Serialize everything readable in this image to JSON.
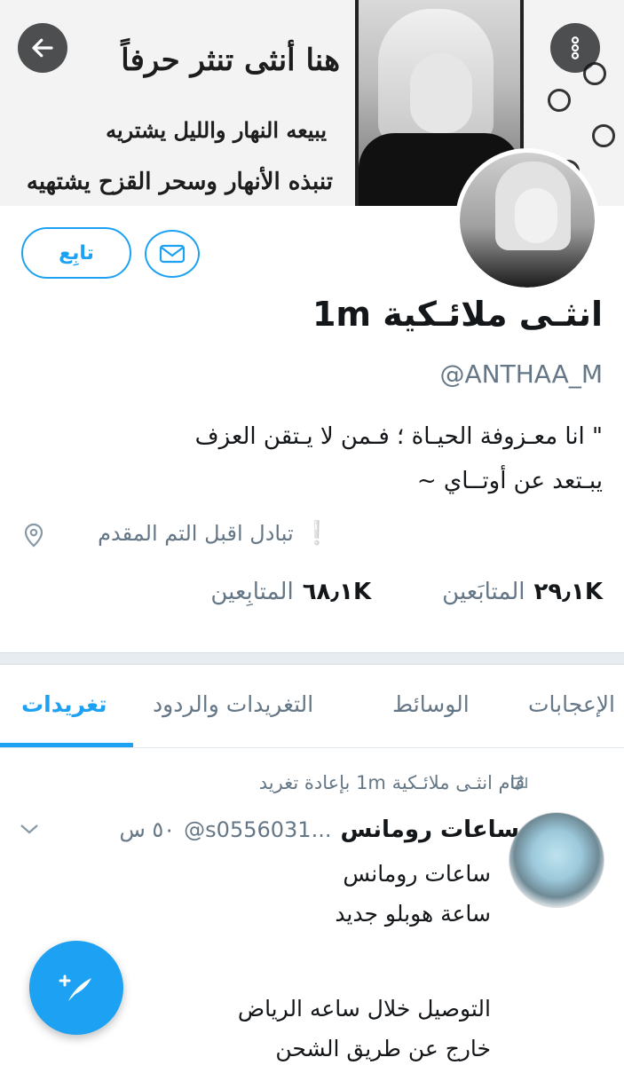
{
  "banner": {
    "line1": "هنا أنثى تنثر حرفاً",
    "line2": "يبيعه النهار والليل يشتريه",
    "line3": "تنبذه الأنهار وسحر القزح يشتهيه"
  },
  "nav": {
    "back_icon": "arrow-left-icon",
    "menu_icon": "more-vertical-icon"
  },
  "profile": {
    "follow_label": "تابِع",
    "dm_icon": "envelope-icon",
    "display_name": "انثـى ملائـكية 1m",
    "handle": "@ANTHAA_M",
    "bio_line1": "\" انا معـزوفة الحيـاة ؛ فـمن لا يـتقن العزف",
    "bio_line2": "يبـتعد عن أوتــاي ~",
    "location": "تبادل  اقبل التم المقدم",
    "location_icon": "map-pin-icon",
    "following_count": "٢٩٫١K",
    "following_label": "المتابَعين",
    "followers_count": "٦٨٫١K",
    "followers_label": "المتابِعين"
  },
  "tabs": [
    {
      "label": "تغريدات",
      "active": true
    },
    {
      "label": "التغريدات والردود",
      "active": false
    },
    {
      "label": "الوسائط",
      "active": false
    },
    {
      "label": "الإعجابات",
      "active": false
    }
  ],
  "tweet": {
    "retweet_text": "قام انثـى ملائـكية 1m بإعادة تغريد",
    "retweet_icon": "retweet-icon",
    "author_name": "ساعات رومانس",
    "author_handle": "@s0556031...",
    "time": "٥٠ س",
    "lines": [
      "ساعات رومانس",
      "ساعة هوبلو جديد",
      "التوصيل خلال ساعه الرياض",
      "خارج عن طريق الشحن"
    ]
  },
  "fab": {
    "icon": "compose-quill-icon"
  },
  "colors": {
    "accent": "#1da1f2",
    "secondary_text": "#657786",
    "primary_text": "#14171a"
  }
}
